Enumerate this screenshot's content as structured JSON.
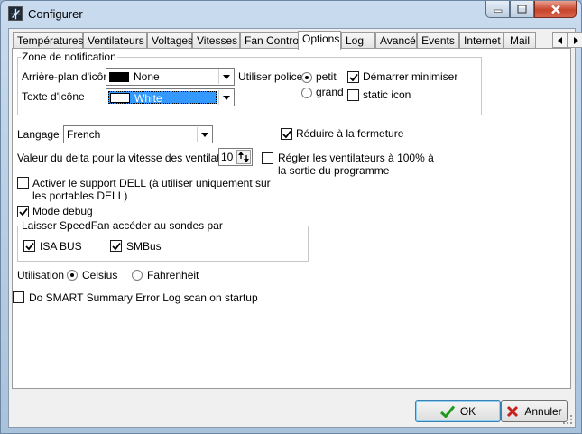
{
  "window": {
    "title": "Configurer",
    "app_icon": "speedfan-icon"
  },
  "tabs": [
    {
      "label": "Températures"
    },
    {
      "label": "Ventilateurs"
    },
    {
      "label": "Voltages"
    },
    {
      "label": "Vitesses"
    },
    {
      "label": "Fan Control"
    },
    {
      "label": "Options",
      "active": true
    },
    {
      "label": "Log"
    },
    {
      "label": "Avancé"
    },
    {
      "label": "Events"
    },
    {
      "label": "Internet"
    },
    {
      "label": "Mail"
    }
  ],
  "notification": {
    "group_label": "Zone de notification",
    "bg_label": "Arrière-plan d'icône",
    "bg_value": "None",
    "bg_color": "#000000",
    "text_label": "Texte d'icône",
    "text_value": "White",
    "text_color": "#ffffff",
    "font_label": "Utiliser police",
    "font_small": "petit",
    "font_large": "grand",
    "font_selected": "petit",
    "start_minimized": "Démarrer minimiser",
    "start_minimized_checked": true,
    "static_icon": "static icon",
    "static_icon_checked": false
  },
  "language": {
    "label": "Langage",
    "value": "French"
  },
  "reduce_on_close": {
    "label": "Réduire à la fermeture",
    "checked": true
  },
  "fan_delta": {
    "label": "Valeur du delta pour la vitesse des ventilateurs",
    "value": "10"
  },
  "fans_100": {
    "line1": "Régler les ventilateurs à 100% à",
    "line2": "la sortie du programme",
    "checked": false
  },
  "dell": {
    "line1": "Activer le support DELL (à utiliser uniquement sur",
    "line2": "les portables DELL)",
    "checked": false
  },
  "debug": {
    "label": "Mode debug",
    "checked": true
  },
  "sensors": {
    "group_label": "Laisser SpeedFan accéder au sondes par",
    "isa": {
      "label": "ISA BUS",
      "checked": true
    },
    "smbus": {
      "label": "SMBus",
      "checked": true
    }
  },
  "units": {
    "label": "Utilisation",
    "celsius": "Celsius",
    "fahrenheit": "Fahrenheit",
    "selected": "Celsius"
  },
  "smart": {
    "label": "Do SMART Summary Error Log scan on startup",
    "checked": false
  },
  "footer": {
    "ok_label": "OK",
    "cancel_label": "Annuler"
  },
  "colors": {
    "accent": "#3399ff",
    "ok_icon": "#1f9a1f",
    "cancel_icon": "#c8201e",
    "close_button": "#c8452c"
  }
}
